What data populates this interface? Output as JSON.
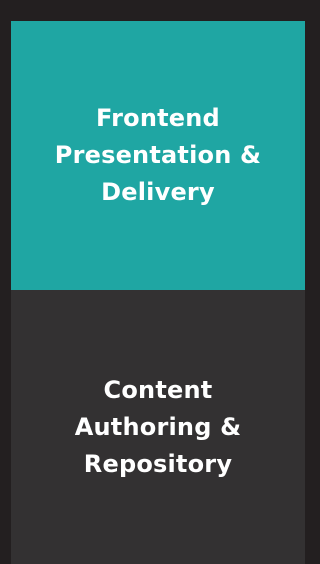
{
  "colors": {
    "background": "#231f20",
    "frontend_layer": "#1fa6a3",
    "content_layer": "#333132",
    "text": "#ffffff"
  },
  "layers": [
    {
      "label": "Frontend\nPresentation &\nDelivery"
    },
    {
      "label": "Content\nAuthoring &\nRepository"
    }
  ]
}
